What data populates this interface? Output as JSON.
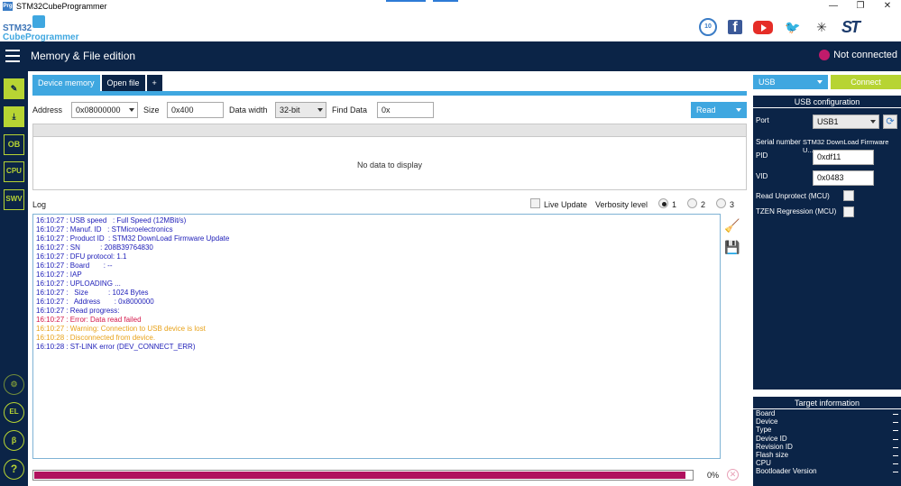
{
  "window": {
    "title": "STM32CubeProgrammer",
    "app_icon": "Prg",
    "controls": [
      "—",
      "❐",
      "✕"
    ]
  },
  "logo": {
    "line1": "STM32",
    "line2": "CubeProgrammer"
  },
  "header_icons": [
    "anniversary-icon",
    "facebook-icon",
    "youtube-icon",
    "twitter-icon",
    "network-icon",
    "st-logo"
  ],
  "anniversary_text": "10",
  "st_logo_text": "ST",
  "topbar": {
    "page_title": "Memory & File edition",
    "connection_status": "Not connected",
    "status_color": "#c11b6b"
  },
  "sidebar": {
    "items": [
      {
        "name": "edit-icon",
        "label": "✎"
      },
      {
        "name": "download-icon",
        "label": "⤓"
      },
      {
        "name": "ob-button",
        "label": "OB"
      },
      {
        "name": "cpu-button",
        "label": "CPU"
      },
      {
        "name": "swv-button",
        "label": "SWV"
      }
    ],
    "bottom_items": [
      {
        "name": "security-icon",
        "label": "⚙"
      },
      {
        "name": "el-icon",
        "label": "EL"
      },
      {
        "name": "beta-icon",
        "label": "β"
      },
      {
        "name": "help-icon",
        "label": "?"
      }
    ]
  },
  "tabs": [
    {
      "label": "Device memory",
      "active": true
    },
    {
      "label": "Open file",
      "active": false
    },
    {
      "label": "+",
      "active": false
    }
  ],
  "toolbar": {
    "address_label": "Address",
    "address_value": "0x08000000",
    "size_label": "Size",
    "size_value": "0x400",
    "data_width_label": "Data width",
    "data_width_value": "32-bit",
    "find_label": "Find Data",
    "find_value": "0x",
    "read_label": "Read"
  },
  "data_panel": {
    "empty_text": "No data to display"
  },
  "log": {
    "title": "Log",
    "live_update_label": "Live Update",
    "verbosity_label": "Verbosity level",
    "levels": [
      "1",
      "2",
      "3"
    ],
    "selected_level": "1",
    "lines": [
      {
        "text": "16:10:27 : USB speed   : Full Speed (12MBit/s)",
        "color": "#1d1db8"
      },
      {
        "text": "16:10:27 : Manuf. ID   : STMicroelectronics",
        "color": "#1d1db8"
      },
      {
        "text": "16:10:27 : Product ID  : STM32 DownLoad Firmware Update",
        "color": "#1d1db8"
      },
      {
        "text": "16:10:27 : SN          : 208B39764830",
        "color": "#1d1db8"
      },
      {
        "text": "16:10:27 : DFU protocol: 1.1",
        "color": "#1d1db8"
      },
      {
        "text": "16:10:27 : Board       : --",
        "color": "#1d1db8"
      },
      {
        "text": "16:10:27 : IAP",
        "color": "#1d1db8"
      },
      {
        "text": "16:10:27 : UPLOADING ...",
        "color": "#1d1db8"
      },
      {
        "text": "16:10:27 :   Size          : 1024 Bytes",
        "color": "#1d1db8"
      },
      {
        "text": "16:10:27 :   Address       : 0x8000000",
        "color": "#1d1db8"
      },
      {
        "text": "16:10:27 : Read progress:",
        "color": "#1d1db8"
      },
      {
        "text": "16:10:27 : Error: Data read failed",
        "color": "#d4174a"
      },
      {
        "text": "16:10:27 : Warning: Connection to USB device is lost",
        "color": "#e8a21a"
      },
      {
        "text": "16:10:28 : Disconnected from device.",
        "color": "#e8a21a"
      },
      {
        "text": "16:10:28 : ST-LINK error (DEV_CONNECT_ERR)",
        "color": "#1d1db8"
      }
    ]
  },
  "progress": {
    "value": 0.99,
    "percent_text": "0%",
    "fill_color": "#b0115e"
  },
  "right_panel": {
    "interface": "USB",
    "connect_label": "Connect",
    "config_title": "USB configuration",
    "port_label": "Port",
    "port_value": "USB1",
    "serial_label": "Serial number",
    "serial_value": "STM32 DownLoad Firmware U...",
    "pid_label": "PID",
    "pid_value": "0xdf11",
    "vid_label": "VID",
    "vid_value": "0x0483",
    "read_unprotect_label": "Read Unprotect (MCU)",
    "tzen_label": "TZEN Regression (MCU)",
    "target_title": "Target information",
    "target_rows": [
      "Board",
      "Device",
      "Type",
      "Device ID",
      "Revision ID",
      "Flash size",
      "CPU",
      "Bootloader Version"
    ]
  },
  "colors": {
    "navy": "#0b2447",
    "accent_blue": "#3fa7e0",
    "accent_green": "#b7d433"
  }
}
